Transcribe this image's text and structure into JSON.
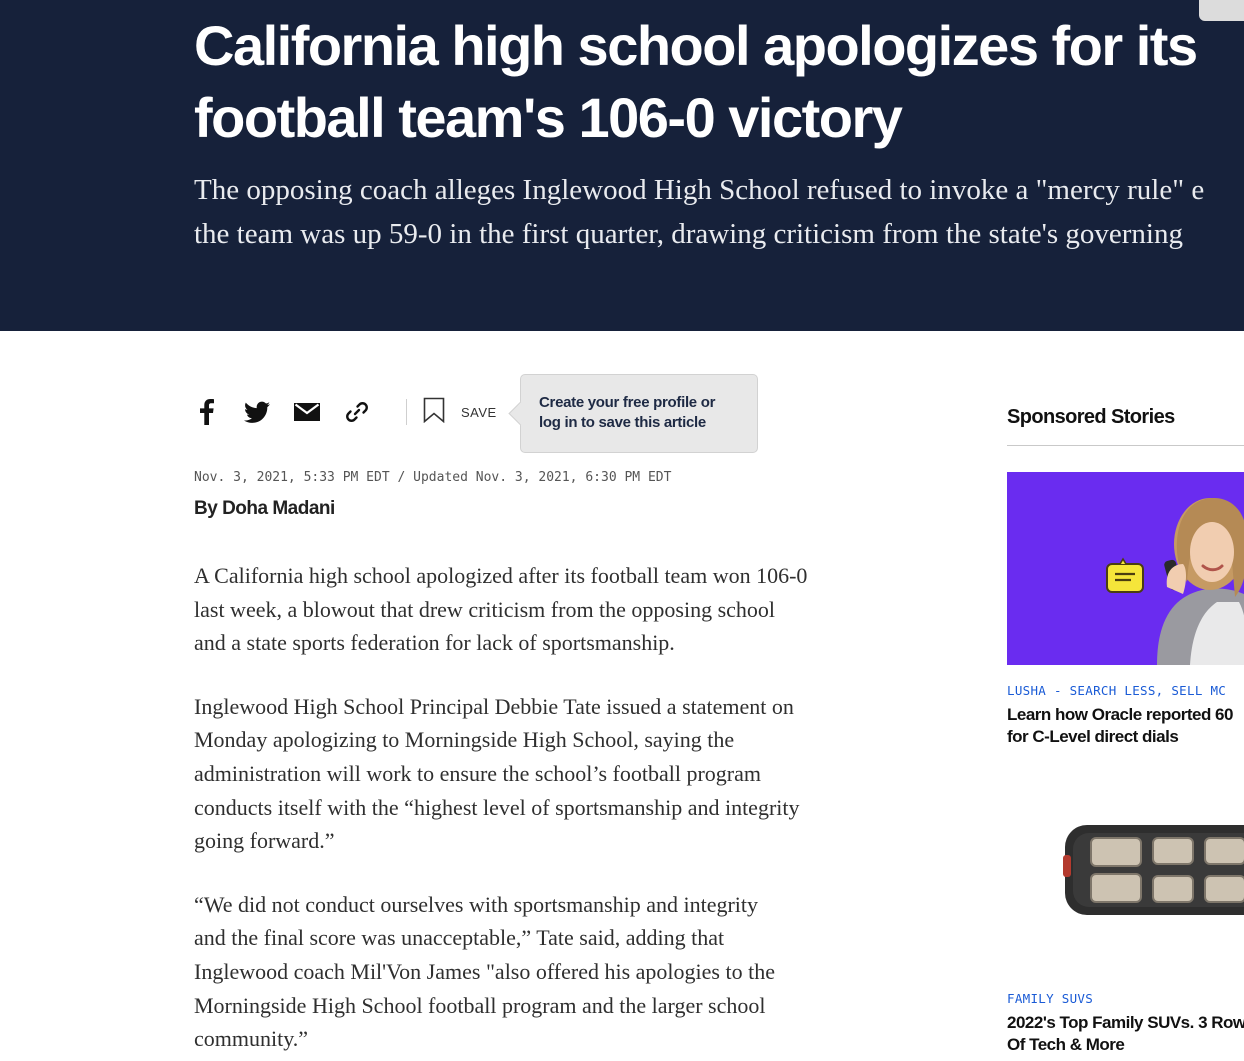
{
  "hero": {
    "headline_line1": "California high school apologizes for its",
    "headline_line2": "football team's 106-0 victory",
    "dek_line1": "The opposing coach alleges Inglewood High School refused to invoke a \"mercy rule\" e",
    "dek_line2": "the team was up 59-0 in the first quarter, drawing criticism from the state's governing"
  },
  "share": {
    "icons": [
      "facebook-icon",
      "twitter-icon",
      "email-icon",
      "link-icon",
      "bookmark-icon"
    ],
    "save_label": "SAVE",
    "tooltip_line1": "Create your free profile or",
    "tooltip_line2": "log in to save this article"
  },
  "meta": {
    "timestamp": "Nov. 3, 2021, 5:33 PM EDT / Updated Nov. 3, 2021, 6:30 PM EDT",
    "byline": "By Doha Madani"
  },
  "article": {
    "p1": [
      "A California high school apologized after its football team won 106-0",
      "last week, a blowout that drew criticism from the opposing school",
      "and a state sports federation for lack of sportsmanship."
    ],
    "p2": [
      "Inglewood High School Principal Debbie Tate issued a statement on",
      "Monday apologizing to Morningside High School, saying the",
      "administration will work to ensure the school’s football program",
      "conducts itself with the “highest level of sportsmanship and integrity",
      "going forward.”"
    ],
    "p3": [
      "“We did not conduct ourselves with sportsmanship and integrity",
      "and the final score was unacceptable,” Tate said, adding that",
      "Inglewood coach Mil'Von James \"also offered his apologies to the",
      "Morningside High School football program and the larger school",
      "community.”"
    ]
  },
  "sidebar": {
    "title": "Sponsored Stories",
    "promos": [
      {
        "source": "LUSHA - SEARCH LESS, SELL MC",
        "headline_line1": "Learn how Oracle reported 60",
        "headline_line2": "for C-Level direct dials"
      },
      {
        "source": "FAMILY SUVS",
        "headline_line1": "2022's Top Family SUVs. 3 Row",
        "headline_line2": "Of Tech & More"
      }
    ]
  },
  "colors": {
    "hero_bg": "#16213a",
    "link_blue": "#1a5bd6",
    "promo_purple": "#6a2cf0"
  }
}
